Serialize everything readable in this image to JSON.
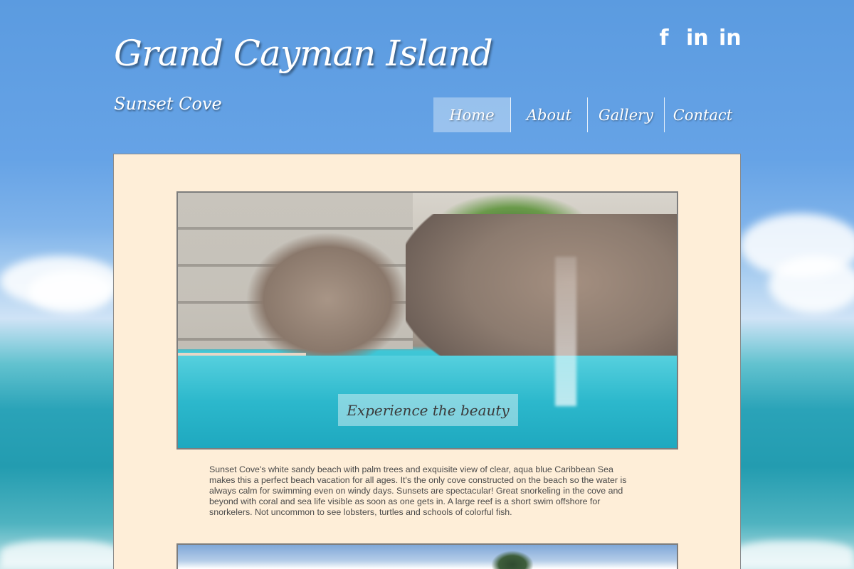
{
  "header": {
    "title": "Grand Cayman Island",
    "subtitle": "Sunset Cove"
  },
  "social": [
    {
      "icon": "facebook-icon",
      "glyph": "f"
    },
    {
      "icon": "linkedin-icon",
      "glyph": "in"
    },
    {
      "icon": "linkedin-icon",
      "glyph": "in"
    }
  ],
  "nav": {
    "items": [
      {
        "label": "Home",
        "active": true
      },
      {
        "label": "About",
        "active": false
      },
      {
        "label": "Gallery",
        "active": false
      },
      {
        "label": "Contact",
        "active": false
      }
    ]
  },
  "main": {
    "hero_caption": "Experience the beauty",
    "description": "Sunset Cove's white sandy beach with palm trees and exquisite view of clear, aqua blue Caribbean Sea\nmakes this a perfect beach vacation for all ages.  It's the only cove constructed on the beach so the water is\nalways calm for swimming even on windy days.  Sunsets are spectacular! Great snorkeling in the cove and\nbeyond with coral and sea life visible as soon as one gets in.  A large reef is a short swim offshore for\nsnorkelers. Not uncommon to see lobsters, turtles and schools of colorful fish."
  },
  "colors": {
    "sky": "#5b9be0",
    "content_background": "#feeed8",
    "text": "#4a4a4a",
    "heading": "#ffffff"
  }
}
